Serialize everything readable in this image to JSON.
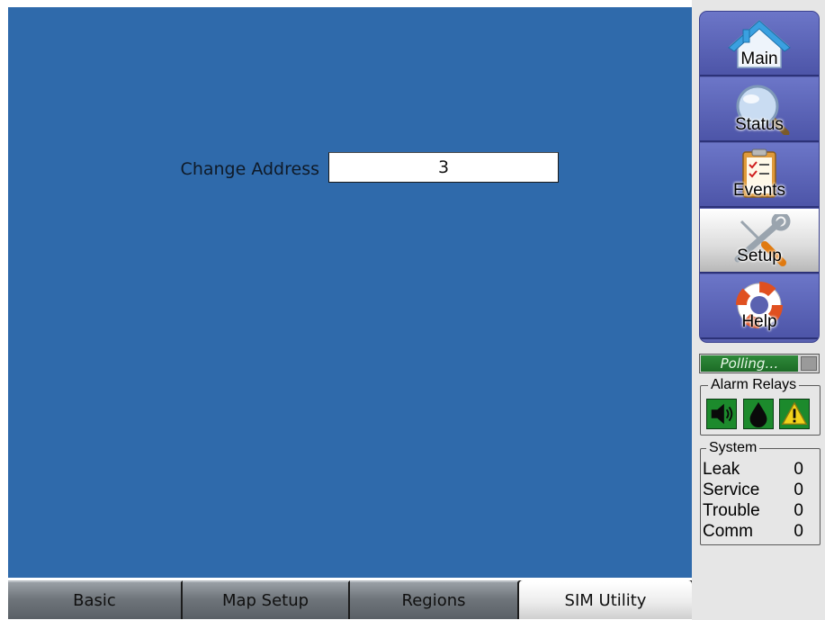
{
  "main": {
    "change_address_label": "Change Address",
    "address_value": "3"
  },
  "tabs": [
    {
      "label": "Basic",
      "active": false
    },
    {
      "label": "Map Setup",
      "active": false
    },
    {
      "label": "Regions",
      "active": false
    },
    {
      "label": "SIM Utility",
      "active": true
    }
  ],
  "nav": [
    {
      "label": "Main",
      "icon": "home-icon",
      "active": false
    },
    {
      "label": "Status",
      "icon": "magnifier-icon",
      "active": false
    },
    {
      "label": "Events",
      "icon": "clipboard-checklist-icon",
      "active": false
    },
    {
      "label": "Setup",
      "icon": "wrench-screwdriver-icon",
      "active": true
    },
    {
      "label": "Help",
      "icon": "lifebuoy-icon",
      "active": false
    }
  ],
  "polling": {
    "text": "Polling…"
  },
  "alarm_relays": {
    "title": "Alarm Relays",
    "icons": [
      "horn-icon",
      "oil-drop-icon",
      "warning-icon"
    ]
  },
  "system": {
    "title": "System",
    "rows": [
      {
        "label": "Leak",
        "value": "0"
      },
      {
        "label": "Service",
        "value": "0"
      },
      {
        "label": "Trouble",
        "value": "0"
      },
      {
        "label": "Comm",
        "value": "0"
      }
    ]
  },
  "colors": {
    "main_background": "#2f6aab",
    "nav_background": "#5a62b0",
    "polling_green": "#2f8a3a",
    "relay_green": "#1c8a2c",
    "warning_yellow": "#f2d21a"
  }
}
